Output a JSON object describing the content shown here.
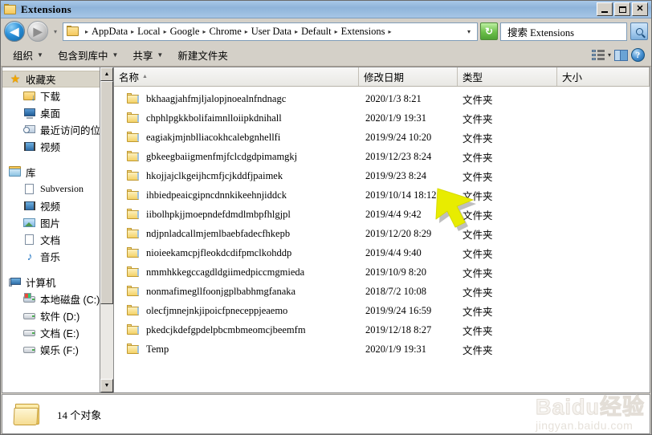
{
  "window": {
    "title": "Extensions",
    "title_icon": "folder-icon",
    "minimize_label": "_",
    "maximize_label": "□",
    "close_label": "✕"
  },
  "navigation": {
    "back_label": "◀",
    "forward_label": "▶",
    "history_caret": "▾",
    "breadcrumbs": [
      "AppData",
      "Local",
      "Google",
      "Chrome",
      "User Data",
      "Default",
      "Extensions"
    ],
    "breadcrumb_separator": "▸",
    "overflow_caret": "▾",
    "refresh_label": "↻"
  },
  "search": {
    "value": "搜索 Extensions",
    "placeholder": "搜索 Extensions",
    "button_icon": "search-icon"
  },
  "command_bar": {
    "items": [
      {
        "label": "组织",
        "has_caret": true
      },
      {
        "label": "包含到库中",
        "has_caret": true
      },
      {
        "label": "共享",
        "has_caret": true
      },
      {
        "label": "新建文件夹",
        "has_caret": false
      }
    ],
    "view_caret": "▾",
    "help_label": "?"
  },
  "sidebar": {
    "groups": [
      {
        "root": {
          "label": "收藏夹",
          "icon": "star-icon",
          "selected": true
        },
        "items": [
          {
            "label": "下载",
            "icon": "downloads-icon"
          },
          {
            "label": "桌面",
            "icon": "desktop-icon"
          },
          {
            "label": "最近访问的位置",
            "icon": "recent-places-icon"
          },
          {
            "label": "视频",
            "icon": "video-icon"
          }
        ]
      },
      {
        "root": {
          "label": "库",
          "icon": "library-icon",
          "selected": false
        },
        "items": [
          {
            "label": "Subversion",
            "icon": "document-icon",
            "latin": true
          },
          {
            "label": "视频",
            "icon": "video-icon"
          },
          {
            "label": "图片",
            "icon": "pictures-icon"
          },
          {
            "label": "文档",
            "icon": "document-icon"
          },
          {
            "label": "音乐",
            "icon": "music-icon"
          }
        ]
      },
      {
        "root": {
          "label": "计算机",
          "icon": "computer-icon",
          "selected": false
        },
        "items": [
          {
            "label": "本地磁盘 (C:)",
            "icon": "system-drive-icon"
          },
          {
            "label": "软件 (D:)",
            "icon": "drive-icon"
          },
          {
            "label": "文档 (E:)",
            "icon": "drive-icon"
          },
          {
            "label": "娱乐 (F:)",
            "icon": "drive-icon"
          }
        ]
      }
    ],
    "scroll_up": "▲",
    "scroll_down": "▼"
  },
  "file_list": {
    "columns": [
      {
        "label": "名称",
        "sorted": "asc",
        "sort_glyph": "▲"
      },
      {
        "label": "修改日期",
        "sorted": "",
        "sort_glyph": ""
      },
      {
        "label": "类型",
        "sorted": "",
        "sort_glyph": ""
      },
      {
        "label": "大小",
        "sorted": "",
        "sort_glyph": ""
      }
    ],
    "rows": [
      {
        "name": "bkhaagjahfmjljalopjnoealnfndnagc",
        "date": "2020/1/3 8:21",
        "type": "文件夹",
        "size": ""
      },
      {
        "name": "chphlpgkkbolifaimnlloiipkdnihall",
        "date": "2020/1/9 19:31",
        "type": "文件夹",
        "size": ""
      },
      {
        "name": "eagiakjmjnblliacokhcalebgnhellfi",
        "date": "2019/9/24 10:20",
        "type": "文件夹",
        "size": ""
      },
      {
        "name": "gbkeegbaiigmenfmjfclcdgdpimamgkj",
        "date": "2019/12/23 8:24",
        "type": "文件夹",
        "size": ""
      },
      {
        "name": "hkojjajclkgeijhcmfjcjkddfjpaimek",
        "date": "2019/9/23 8:24",
        "type": "文件夹",
        "size": ""
      },
      {
        "name": "ihbiedpeaicgipncdnnkikeehnjiddck",
        "date": "2019/10/14 18:12",
        "type": "文件夹",
        "size": ""
      },
      {
        "name": "iibolhpkjjmoepndefdmdlmbpfhlgjpl",
        "date": "2019/4/4 9:42",
        "type": "文件夹",
        "size": ""
      },
      {
        "name": "ndjpnladcallmjemlbaebfadecfhkepb",
        "date": "2019/12/20 8:29",
        "type": "文件夹",
        "size": ""
      },
      {
        "name": "nioieekamcpjfleokdcdifpmclkohddp",
        "date": "2019/4/4 9:40",
        "type": "文件夹",
        "size": ""
      },
      {
        "name": "nmmhkkegccagdldgiimedpiccmgmieda",
        "date": "2019/10/9 8:20",
        "type": "文件夹",
        "size": ""
      },
      {
        "name": "nonmafimegllfoonjgplbabhmgfanaka",
        "date": "2018/7/2 10:08",
        "type": "文件夹",
        "size": ""
      },
      {
        "name": "olecfjmnejnkjipoicfpneceppjeaemo",
        "date": "2019/9/24 16:59",
        "type": "文件夹",
        "size": ""
      },
      {
        "name": "pkedcjkdefgpdelpbcmbmeomcjbeemfm",
        "date": "2019/12/18 8:27",
        "type": "文件夹",
        "size": ""
      },
      {
        "name": "Temp",
        "date": "2020/1/9 19:31",
        "type": "文件夹",
        "size": ""
      }
    ]
  },
  "status_bar": {
    "icon": "folder-icon",
    "text": "14 个对象"
  },
  "watermark": {
    "main": "Baidu经验",
    "sub": "jingyan.baidu.com"
  },
  "annotation": {
    "cursor_icon": "arrow-cursor-icon",
    "color": "#e8ec00"
  }
}
